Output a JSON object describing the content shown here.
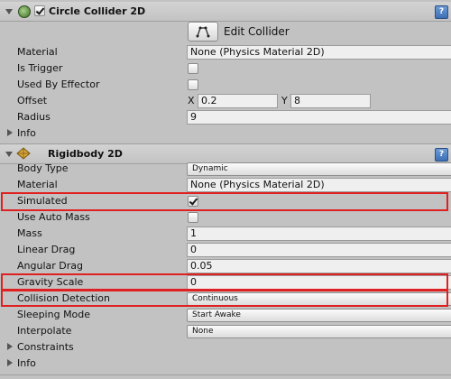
{
  "circle_collider": {
    "title": "Circle Collider 2D",
    "enabled": true,
    "edit_collider_label": "Edit Collider",
    "rows": {
      "material_label": "Material",
      "material_value": "None (Physics Material 2D)",
      "is_trigger_label": "Is Trigger",
      "is_trigger_checked": false,
      "used_by_effector_label": "Used By Effector",
      "used_by_effector_checked": false,
      "offset_label": "Offset",
      "offset_x_label": "X",
      "offset_x_value": "0.2",
      "offset_y_label": "Y",
      "offset_y_value": "8",
      "radius_label": "Radius",
      "radius_value": "9",
      "info_label": "Info"
    }
  },
  "rigidbody": {
    "title": "Rigidbody 2D",
    "rows": {
      "body_type_label": "Body Type",
      "body_type_value": "Dynamic",
      "material_label": "Material",
      "material_value": "None (Physics Material 2D)",
      "simulated_label": "Simulated",
      "simulated_checked": true,
      "use_auto_mass_label": "Use Auto Mass",
      "use_auto_mass_checked": false,
      "mass_label": "Mass",
      "mass_value": "1",
      "linear_drag_label": "Linear Drag",
      "linear_drag_value": "0",
      "angular_drag_label": "Angular Drag",
      "angular_drag_value": "0.05",
      "gravity_scale_label": "Gravity Scale",
      "gravity_scale_value": "0",
      "collision_detection_label": "Collision Detection",
      "collision_detection_value": "Continuous",
      "sleeping_mode_label": "Sleeping Mode",
      "sleeping_mode_value": "Start Awake",
      "interpolate_label": "Interpolate",
      "interpolate_value": "None",
      "constraints_label": "Constraints",
      "info_label": "Info"
    }
  },
  "colors": {
    "highlight": "#e02020",
    "panel_bg": "#c2c2c2",
    "help_icon": "#4a7cc0"
  },
  "icons": {
    "collider_icon": "circle-collider-icon",
    "rigidbody_icon": "rigidbody-icon",
    "help": "help-icon",
    "edit_collider": "edit-collider-icon"
  }
}
